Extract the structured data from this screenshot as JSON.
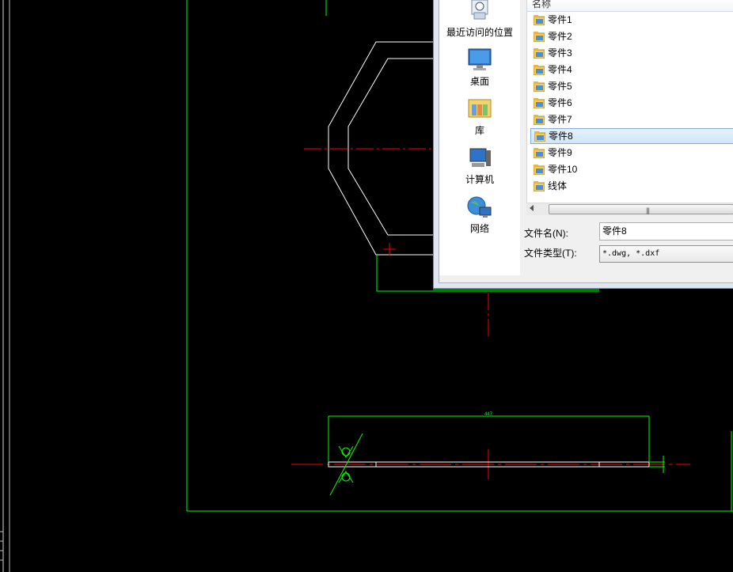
{
  "cad": {
    "dimension_text": "447",
    "colors": {
      "geometry": "#ffffff",
      "frame": "#00ff00",
      "centerline": "#ff0000"
    }
  },
  "dialog": {
    "places": [
      {
        "label": "最近访问的位置",
        "icon": "recent-places-icon"
      },
      {
        "label": "桌面",
        "icon": "desktop-icon"
      },
      {
        "label": "库",
        "icon": "libraries-icon"
      },
      {
        "label": "计算机",
        "icon": "computer-icon"
      },
      {
        "label": "网络",
        "icon": "network-icon"
      }
    ],
    "list_header": "名称",
    "items": [
      {
        "name": "零件1",
        "selected": false
      },
      {
        "name": "零件2",
        "selected": false
      },
      {
        "name": "零件3",
        "selected": false
      },
      {
        "name": "零件4",
        "selected": false
      },
      {
        "name": "零件5",
        "selected": false
      },
      {
        "name": "零件6",
        "selected": false
      },
      {
        "name": "零件7",
        "selected": false
      },
      {
        "name": "零件8",
        "selected": true
      },
      {
        "name": "零件9",
        "selected": false
      },
      {
        "name": "零件10",
        "selected": false
      },
      {
        "name": "线体",
        "selected": false
      }
    ],
    "scroll_grip": "|||",
    "filename_label": "文件名(N):",
    "filename_value": "零件8",
    "filetype_label": "文件类型(T):",
    "filetype_value": "*.dwg, *.dxf"
  }
}
